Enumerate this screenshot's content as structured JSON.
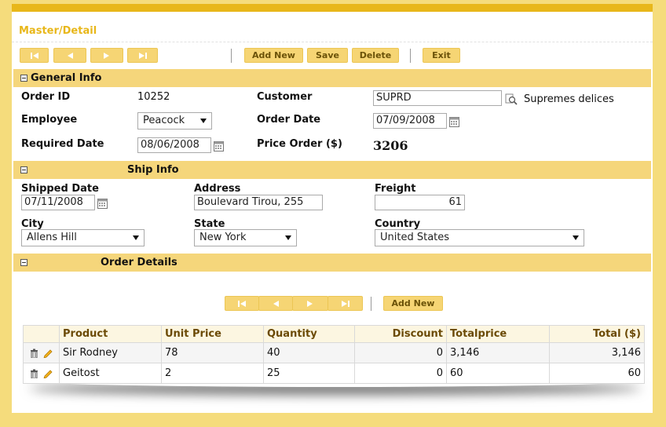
{
  "app": {
    "title": "Master/Detail"
  },
  "toolbar": {
    "add_new": "Add New",
    "save": "Save",
    "delete": "Delete",
    "exit": "Exit"
  },
  "general": {
    "section_title": "General Info",
    "order_id_label": "Order ID",
    "order_id": "10252",
    "customer_label": "Customer",
    "customer_code": "SUPRD",
    "customer_name": "Supremes delices",
    "employee_label": "Employee",
    "employee": "Peacock",
    "order_date_label": "Order Date",
    "order_date": "07/09/2008",
    "required_date_label": "Required Date",
    "required_date": "08/06/2008",
    "price_order_label": "Price Order ($)",
    "price_order": "3206"
  },
  "ship": {
    "section_title": "Ship Info",
    "shipped_date_label": "Shipped Date",
    "shipped_date": "07/11/2008",
    "address_label": "Address",
    "address": "Boulevard Tirou, 255",
    "freight_label": "Freight",
    "freight": "61",
    "city_label": "City",
    "city": "Allens Hill",
    "state_label": "State",
    "state": "New York",
    "country_label": "Country",
    "country": "United States"
  },
  "details": {
    "section_title": "Order Details",
    "add_new": "Add New",
    "columns": [
      "Product",
      "Unit Price",
      "Quantity",
      "Discount",
      "Totalprice",
      "Total ($)"
    ],
    "rows": [
      {
        "product": "Sir Rodney",
        "unit_price": "78",
        "quantity": "40",
        "discount": "0",
        "totalprice": "3,146",
        "total": "3,146"
      },
      {
        "product": "Geitost",
        "unit_price": "2",
        "quantity": "25",
        "discount": "0",
        "totalprice": "60",
        "total": "60"
      }
    ]
  },
  "colors": {
    "background": "#f5dc7c",
    "accent": "#e8b71a",
    "section_bar": "#f5d67b",
    "button": "#f6d574"
  }
}
